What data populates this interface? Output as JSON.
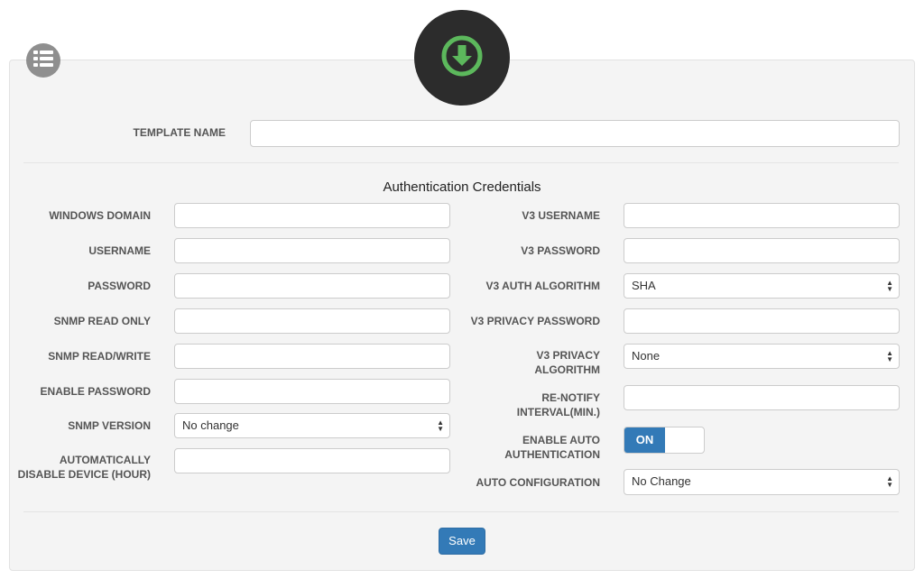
{
  "header": {
    "menu_icon": "list-icon",
    "hero_icon": "download-arrow-circle-icon",
    "hero_icon_color": "#5cb85c"
  },
  "template": {
    "name_label": "TEMPLATE NAME",
    "name_value": ""
  },
  "section_title": "Authentication Credentials",
  "left_fields": {
    "windows_domain": "WINDOWS DOMAIN",
    "username": "USERNAME",
    "password": "PASSWORD",
    "snmp_read_only": "SNMP READ ONLY",
    "snmp_read_write": "SNMP READ/WRITE",
    "enable_password": "ENABLE PASSWORD",
    "snmp_version": "SNMP VERSION",
    "snmp_version_value": "No change",
    "auto_disable_line1": "AUTOMATICALLY",
    "auto_disable_line2": "DISABLE DEVICE (HOUR)"
  },
  "right_fields": {
    "v3_username": "V3 USERNAME",
    "v3_password": "V3 PASSWORD",
    "v3_auth_algorithm": "V3 AUTH ALGORITHM",
    "v3_auth_algorithm_value": "SHA",
    "v3_privacy_password": "V3 PRIVACY PASSWORD",
    "v3_privacy_algorithm_line1": "V3 PRIVACY",
    "v3_privacy_algorithm_line2": "ALGORITHM",
    "v3_privacy_algorithm_value": "None",
    "renotify_line1": "RE-NOTIFY",
    "renotify_line2": "INTERVAL(MIN.)",
    "enable_auto_auth_line1": "ENABLE AUTO",
    "enable_auto_auth_line2": "AUTHENTICATION",
    "toggle_state": "ON",
    "auto_configuration": "AUTO CONFIGURATION",
    "auto_configuration_value": "No Change"
  },
  "actions": {
    "save_label": "Save",
    "accent_color": "#337ab7"
  }
}
